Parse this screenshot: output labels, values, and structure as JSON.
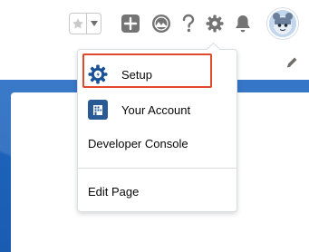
{
  "header": {
    "icons": [
      "favorite-star-icon",
      "favorites-dropdown-icon",
      "global-actions-icon",
      "trailhead-icon",
      "help-icon",
      "setup-gear-icon",
      "notifications-bell-icon",
      "user-avatar"
    ]
  },
  "menu": {
    "items": [
      {
        "label": "Setup",
        "icon": "setup-gear-icon",
        "highlighted": true
      },
      {
        "label": "Your Account",
        "icon": "your-account-icon"
      },
      {
        "label": "Developer Console"
      },
      {
        "label": "Edit Page"
      }
    ]
  },
  "colors": {
    "brand_blue": "#1f67c2",
    "highlight_red": "#e04a2a",
    "icon_gray": "#747474",
    "setup_icon": "#1b5297"
  }
}
